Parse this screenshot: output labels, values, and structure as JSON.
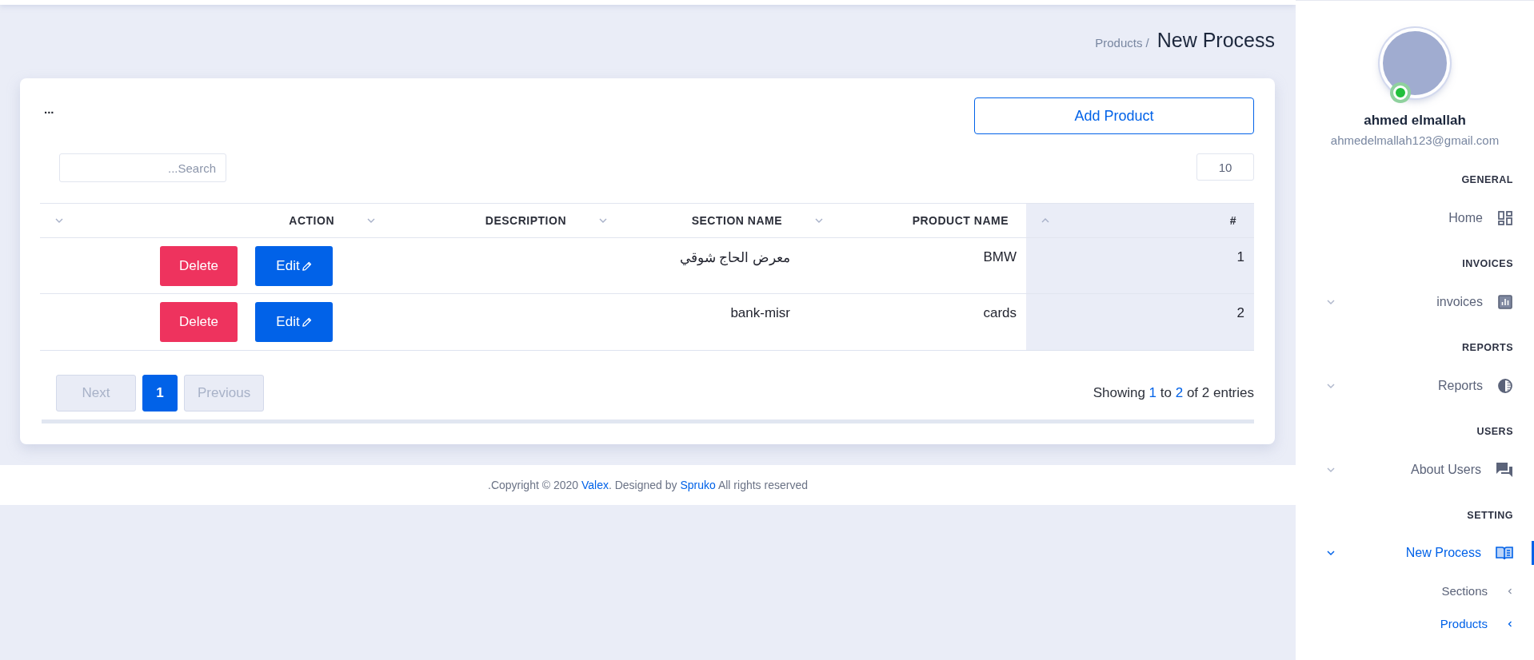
{
  "breadcrumb": {
    "parent": "Products /",
    "current": "New Process"
  },
  "card": {
    "menu": "...",
    "add_button": "Add Product",
    "search": {
      "placeholder": "...Search"
    },
    "page_size": "10",
    "table": {
      "columns": [
        {
          "label": "ACTION",
          "sorted": false
        },
        {
          "label": "DESCRIPTION",
          "sorted": false
        },
        {
          "label": "SECTION NAME",
          "sorted": false
        },
        {
          "label": "PRODUCT NAME",
          "sorted": false
        },
        {
          "label": "#",
          "sorted": true
        }
      ],
      "rows": [
        {
          "delete": "Delete",
          "edit": "Edit",
          "section": "معرض الحاج شوقي",
          "product": "BMW",
          "number": "1"
        },
        {
          "delete": "Delete",
          "edit": "Edit",
          "section": "bank-misr",
          "product": "cards",
          "number": "2"
        }
      ]
    },
    "info": {
      "before": "Showing ",
      "from": "1",
      "mid1": " to ",
      "to": "2",
      "mid2": " of ",
      "total": "2",
      "after": " entries"
    },
    "pagination": [
      {
        "label": "Next",
        "selected": false,
        "disabled": true
      },
      {
        "label": "1",
        "selected": true,
        "disabled": false
      },
      {
        "label": "Previous",
        "selected": false,
        "disabled": true
      }
    ]
  },
  "footer": {
    "before": ".Copyright © 2020 ",
    "link1": "Valex",
    "mid": ". Designed by ",
    "link2": "Spruko",
    "after": " All rights reserved"
  },
  "sidebar": {
    "user": {
      "name": "ahmed elmallah",
      "email": "ahmedelmallah123@gmail.com",
      "online": true
    },
    "sections": [
      {
        "title": "GENERAL",
        "item": {
          "label": "Home",
          "expandable": false,
          "active": false
        }
      },
      {
        "title": "INVOICES",
        "item": {
          "label": "invoices",
          "expandable": true,
          "active": false
        }
      },
      {
        "title": "REPORTS",
        "item": {
          "label": "Reports",
          "expandable": true,
          "active": false
        }
      },
      {
        "title": "USERS",
        "item": {
          "label": "About Users",
          "expandable": true,
          "active": false
        }
      },
      {
        "title": "SETTING",
        "item": {
          "label": "New Process",
          "expandable": true,
          "active": true,
          "children": [
            {
              "label": "Sections",
              "selected": false
            },
            {
              "label": "Products",
              "selected": true
            }
          ]
        }
      }
    ]
  }
}
